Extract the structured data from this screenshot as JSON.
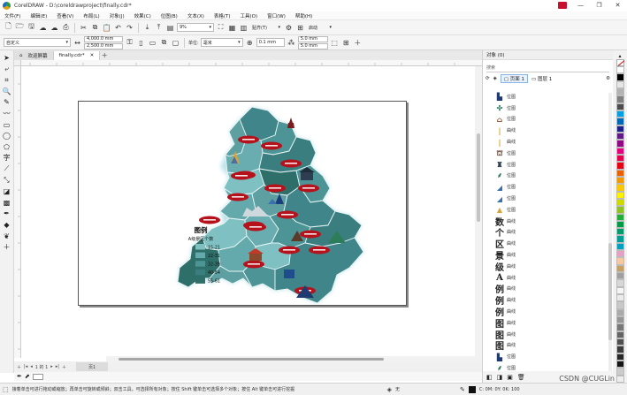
{
  "window": {
    "title": "CorelDRAW - D:\\coreldrawproject\\finally.cdr*",
    "minimize": "—",
    "restore": "❐",
    "close": "✕"
  },
  "menu": [
    "文件(F)",
    "编辑(E)",
    "查看(V)",
    "布局(L)",
    "对象(J)",
    "效果(C)",
    "位图(B)",
    "文本(X)",
    "表格(T)",
    "工具(O)",
    "窗口(W)",
    "帮助(H)"
  ],
  "toolbar": {
    "zoom_value": "9%",
    "snap_label": "贴齐(T)",
    "launch_label": "启动"
  },
  "property_bar": {
    "preset": "自定义",
    "page_width": "4,000.0 mm",
    "page_height": "2,500.0 mm",
    "units_label": "单位:",
    "units_value": "毫米",
    "nudge": "0.1 mm",
    "dup_x": "5.0 mm",
    "dup_y": "5.0 mm"
  },
  "doc_tabs": {
    "welcome": "欢迎屏幕",
    "file": "finally.cdr*"
  },
  "map": {
    "legend_title": "图例",
    "legend_subtitle": "A级景区个数",
    "legend_items": [
      {
        "label": "15-21",
        "color": "#7fc1c2"
      },
      {
        "label": "22-31",
        "color": "#64a9ab"
      },
      {
        "label": "32-39",
        "color": "#4d9496"
      },
      {
        "label": "40-54",
        "color": "#3a7e80"
      },
      {
        "label": "55-61",
        "color": "#2f6f6a"
      }
    ]
  },
  "page_nav": {
    "indicator": "1 的 1",
    "page_tab": "页1"
  },
  "objects_panel": {
    "title": "对象 (0)",
    "search_placeholder": "搜索",
    "page_label": "页面 1",
    "layer_label": "图层 1",
    "items": [
      {
        "icon": "tower",
        "label": "位图"
      },
      {
        "icon": "windmill",
        "label": "位图"
      },
      {
        "icon": "house",
        "label": "位图"
      },
      {
        "icon": "pillar",
        "label": "曲线"
      },
      {
        "icon": "pillar",
        "label": "曲线"
      },
      {
        "icon": "pavilion",
        "label": "位图"
      },
      {
        "icon": "pagoda",
        "label": "位图"
      },
      {
        "icon": "tree",
        "label": "位图"
      },
      {
        "icon": "mountain",
        "label": "位图"
      },
      {
        "icon": "mountain",
        "label": "位图"
      },
      {
        "icon": "spire",
        "label": "位图"
      },
      {
        "glyph": "数",
        "label": "曲线"
      },
      {
        "glyph": "个",
        "label": "曲线"
      },
      {
        "glyph": "区",
        "label": "曲线"
      },
      {
        "glyph": "景",
        "label": "曲线"
      },
      {
        "glyph": "级",
        "label": "曲线"
      },
      {
        "glyph": "A",
        "label": "曲线"
      },
      {
        "glyph": "例",
        "label": "曲线"
      },
      {
        "glyph": "例",
        "label": "曲线"
      },
      {
        "glyph": "例",
        "label": "曲线"
      },
      {
        "glyph": "图",
        "label": "曲线"
      },
      {
        "glyph": "图",
        "label": "曲线"
      },
      {
        "glyph": "图",
        "label": "曲线"
      },
      {
        "icon": "tower",
        "label": "位图"
      },
      {
        "icon": "tree",
        "label": "位图"
      }
    ]
  },
  "status": {
    "hint": "接着单击可进行拖动或缩放；再单击可旋转或倾斜；双击工具，可选择所有对象；按住 Shift 键单击可选择多个对象；按住 Alt 键单击可进行挖掘",
    "fill": "无",
    "color_values": "C: 0M: 0Y: 0K: 100"
  },
  "palette": [
    "#ffffff",
    "#000000",
    "#e6e6e6",
    "#b3b3b3",
    "#808080",
    "#4d4d4d",
    "#00a0e9",
    "#0068b7",
    "#1d2088",
    "#601986",
    "#920783",
    "#e4007f",
    "#e5004f",
    "#e60012",
    "#eb6100",
    "#f39800",
    "#fcc800",
    "#fff100",
    "#cfdb00",
    "#8fc31f",
    "#22ac38",
    "#009944",
    "#009b6b",
    "#009e96",
    "#00a0c1",
    "#e6a0c4",
    "#fac8a0",
    "#c8a064",
    "#a0a0a0",
    "#d7d7d7",
    "#f5f5f5",
    "#ebebeb",
    "#c8c8c8",
    "#aaaaaa",
    "#969696",
    "#787878",
    "#646464",
    "#505050",
    "#3c3c3c",
    "#282828",
    "#141414",
    "#cccccc",
    "#eeeeee"
  ],
  "watermark": "CSDN @CUGLin"
}
